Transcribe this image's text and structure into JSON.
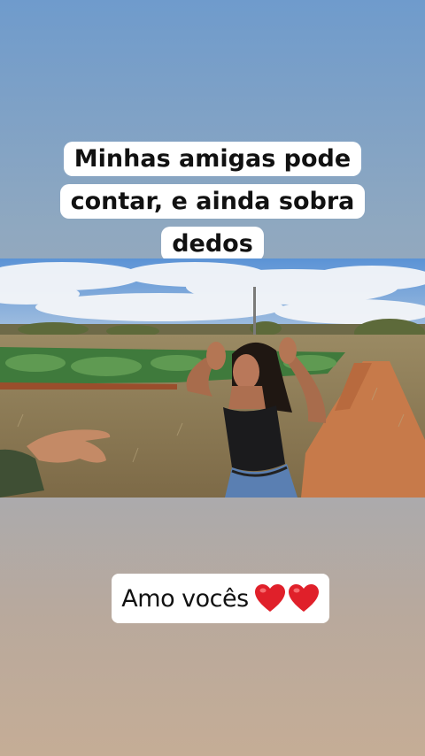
{
  "story": {
    "top_caption": "Minhas amigas pode contar, e ainda sobra dedos",
    "bottom_caption": "Amo vocês",
    "bottom_icons": [
      "red-heart-icon",
      "red-heart-icon"
    ],
    "heart_color": "#e0202a"
  },
  "photo": {
    "icon": "photo-icon"
  }
}
